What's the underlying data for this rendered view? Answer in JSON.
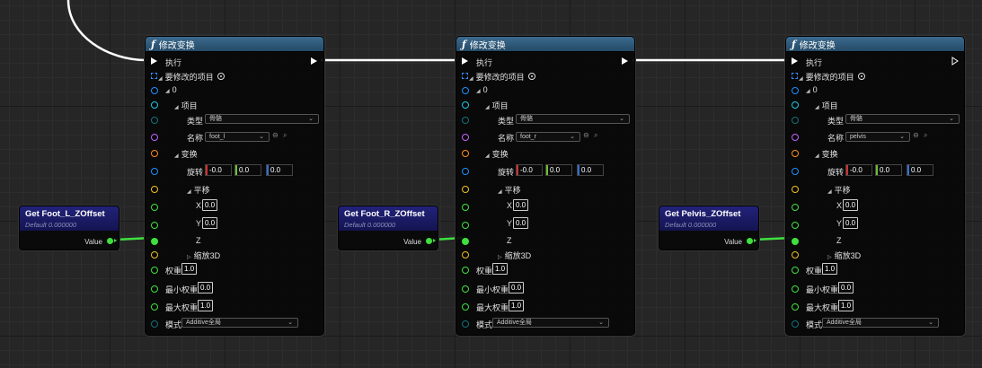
{
  "nodes": [
    {
      "title": "修改变换",
      "exec_label": "执行",
      "modify_label": "要修改的项目",
      "index_label": "0",
      "item_label": "项目",
      "type_label": "类型",
      "type_value": "骨骼",
      "name_label": "名称",
      "name_value": "foot_l",
      "transform_label": "变换",
      "rotation_label": "旋转",
      "rot_x": "-0.0",
      "rot_y": "0.0",
      "rot_z": "0.0",
      "translation_label": "平移",
      "tx_label": "X",
      "tx_value": "0.0",
      "ty_label": "Y",
      "ty_value": "0.0",
      "tz_label": "Z",
      "scale_label": "缩放3D",
      "weight_label": "权重",
      "weight_value": "1.0",
      "min_weight_label": "最小权重",
      "min_weight_value": "0.0",
      "max_weight_label": "最大权重",
      "max_weight_value": "1.0",
      "mode_label": "模式",
      "mode_value": "Additive全局"
    },
    {
      "title": "修改变换",
      "exec_label": "执行",
      "modify_label": "要修改的项目",
      "index_label": "0",
      "item_label": "项目",
      "type_label": "类型",
      "type_value": "骨骼",
      "name_label": "名称",
      "name_value": "foot_r",
      "transform_label": "变换",
      "rotation_label": "旋转",
      "rot_x": "-0.0",
      "rot_y": "0.0",
      "rot_z": "0.0",
      "translation_label": "平移",
      "tx_label": "X",
      "tx_value": "0.0",
      "ty_label": "Y",
      "ty_value": "0.0",
      "tz_label": "Z",
      "scale_label": "缩放3D",
      "weight_label": "权重",
      "weight_value": "1.0",
      "min_weight_label": "最小权重",
      "min_weight_value": "0.0",
      "max_weight_label": "最大权重",
      "max_weight_value": "1.0",
      "mode_label": "模式",
      "mode_value": "Additive全局"
    },
    {
      "title": "修改变换",
      "exec_label": "执行",
      "modify_label": "要修改的项目",
      "index_label": "0",
      "item_label": "项目",
      "type_label": "类型",
      "type_value": "骨骼",
      "name_label": "名称",
      "name_value": "pelvis",
      "transform_label": "变换",
      "rotation_label": "旋转",
      "rot_x": "-0.0",
      "rot_y": "0.0",
      "rot_z": "0.0",
      "translation_label": "平移",
      "tx_label": "X",
      "tx_value": "0.0",
      "ty_label": "Y",
      "ty_value": "0.0",
      "tz_label": "Z",
      "scale_label": "缩放3D",
      "weight_label": "权重",
      "weight_value": "1.0",
      "min_weight_label": "最小权重",
      "min_weight_value": "0.0",
      "max_weight_label": "最大权重",
      "max_weight_value": "1.0",
      "mode_label": "模式",
      "mode_value": "Additive全局"
    }
  ],
  "get_nodes": [
    {
      "title": "Get Foot_L_ZOffset",
      "subtitle": "Default 0.000000",
      "value_label": "Value"
    },
    {
      "title": "Get Foot_R_ZOffset",
      "subtitle": "Default 0.000000",
      "value_label": "Value"
    },
    {
      "title": "Get Pelvis_ZOffset",
      "subtitle": "Default 0.000000",
      "value_label": "Value"
    }
  ],
  "colors": {
    "exec": "#ffffff",
    "float_pin": "#3fe03f",
    "struct_pin": "#1e90ff",
    "transform_pin": "#ff8c1a",
    "vector_pin": "#f0c020",
    "name_pin": "#c060ff",
    "enum_pin": "#15707a",
    "header": "#2f5a7c",
    "get_header": "#1a1a66"
  },
  "icons": {
    "function": "function-icon",
    "exec": "exec-pin-icon",
    "add": "add-pin-icon",
    "search": "search-icon",
    "reset": "reset-icon"
  }
}
